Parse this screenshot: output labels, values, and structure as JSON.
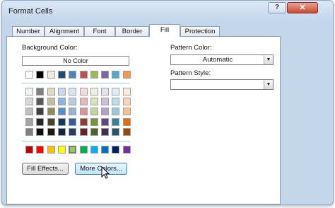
{
  "window": {
    "title": "Format Cells",
    "help_label": "?",
    "close_label": "✕"
  },
  "tabs": [
    {
      "label": "Number",
      "active": false
    },
    {
      "label": "Alignment",
      "active": false
    },
    {
      "label": "Font",
      "active": false
    },
    {
      "label": "Border",
      "active": false
    },
    {
      "label": "Fill",
      "active": true
    },
    {
      "label": "Protection",
      "active": false
    }
  ],
  "background": {
    "label": "Background Color:",
    "no_color_label": "No Color",
    "theme_top_row": [
      "#ffffff",
      "#000000",
      "#eeece1",
      "#1f497d",
      "#4f81bd",
      "#c0504d",
      "#9bbb59",
      "#8064a2",
      "#4bacc6",
      "#f79646"
    ],
    "theme_shades": [
      [
        "#f2f2f2",
        "#7f7f7f",
        "#ddd9c3",
        "#c6d9f0",
        "#dbe5f1",
        "#f2dcdb",
        "#ebf1dd",
        "#e5e0ec",
        "#dbeef3",
        "#fdeada"
      ],
      [
        "#d8d8d8",
        "#595959",
        "#c4bd97",
        "#8db3e2",
        "#b8cce4",
        "#e5b9b7",
        "#d7e3bc",
        "#ccc1d9",
        "#b7dde8",
        "#fbd5b5"
      ],
      [
        "#bfbfbf",
        "#3f3f3f",
        "#938953",
        "#548dd4",
        "#95b3d7",
        "#d99694",
        "#c3d69b",
        "#b2a2c7",
        "#92cddc",
        "#fac08f"
      ],
      [
        "#a5a5a5",
        "#262626",
        "#494429",
        "#17365d",
        "#366092",
        "#953734",
        "#76923c",
        "#5f497a",
        "#31859b",
        "#e36c09"
      ],
      [
        "#7f7f7f",
        "#0c0c0c",
        "#1d1b10",
        "#0f243e",
        "#244061",
        "#632423",
        "#4f6128",
        "#3f3151",
        "#205867",
        "#974806"
      ]
    ],
    "standard_colors": [
      "#c00000",
      "#ff0000",
      "#ffc000",
      "#ffff00",
      "#92d050",
      "#00b050",
      "#00b0f0",
      "#0070c0",
      "#002060",
      "#7030a0"
    ],
    "selected_standard_index": 4
  },
  "pattern": {
    "color_label": "Pattern Color:",
    "color_value": "Automatic",
    "style_label": "Pattern Style:",
    "style_value": ""
  },
  "buttons": {
    "fill_effects": "Fill Effects...",
    "more_colors": "More Colors..."
  },
  "icons": {
    "dropdown": "chevron-down-icon",
    "cursor": "mouse-pointer-icon"
  }
}
